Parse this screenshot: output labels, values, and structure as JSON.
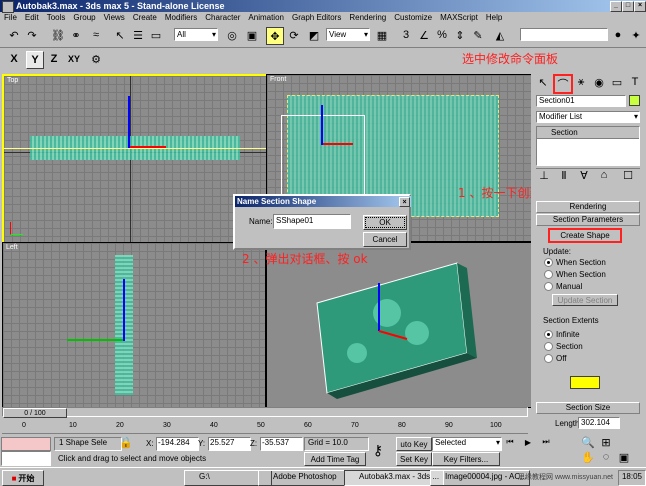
{
  "window": {
    "title": "Autobak3.max - 3ds max 5 - Stand-alone License"
  },
  "menu": [
    "File",
    "Edit",
    "Tools",
    "Group",
    "Views",
    "Create",
    "Modifiers",
    "Character",
    "Animation",
    "Graph Editors",
    "Rendering",
    "Customize",
    "MAXScript",
    "Help"
  ],
  "toolbar": {
    "selection_filter": "All",
    "ref_coord": "View"
  },
  "axis_buttons": [
    "X",
    "Y",
    "Z",
    "XY"
  ],
  "viewports": {
    "top": "Top",
    "front": "Front",
    "left": "Left"
  },
  "dialog": {
    "title": "Name Section Shape",
    "name_label": "Name:",
    "name_value": "SShape01",
    "ok_label": "OK",
    "cancel_label": "Cancel"
  },
  "command_panel": {
    "object_name": "Section01",
    "modifier_list": "Modifier List",
    "stack_item": "Section",
    "rollout_rendering": "Rendering",
    "rollout_section_params": "Section Parameters",
    "create_shape_label": "Create Shape",
    "update_label": "Update:",
    "update_options": [
      "When Section",
      "When Section",
      "Manual"
    ],
    "update_section_btn": "Update Section",
    "extents_label": "Section Extents",
    "extents_options": [
      "Infinite",
      "Section",
      "Off"
    ],
    "rollout_section_size": "Section Size",
    "length_label": "Length:",
    "length_value": "302.104"
  },
  "annotations": {
    "select_modify": "选中修改命令面板",
    "step1": "1 、按一下创建二维线按扭",
    "step2": "2 、弹出对话框、按 ok"
  },
  "timeline": {
    "frame_display": "0 / 100",
    "ticks": [
      "0",
      "10",
      "20",
      "30",
      "40",
      "50",
      "60",
      "70",
      "80",
      "90",
      "100"
    ]
  },
  "status": {
    "selected": "1 Shape Sele",
    "x_label": "X:",
    "x_value": "-194.284",
    "y_label": "Y:",
    "y_value": "25.527",
    "z_label": "Z:",
    "z_value": "-35.537",
    "grid": "Grid = 10.0",
    "prompt": "Click and drag to select and move objects",
    "add_time_tag": "Add Time Tag",
    "auto_key": "uto Key",
    "set_key": "Set Key",
    "selected_dropdown": "Selected",
    "key_filters": "Key Filters..."
  },
  "taskbar": {
    "start": "开始",
    "items": [
      "G:\\",
      "Adobe Photoshop",
      "Autobak3.max - 3ds ...",
      "Image00004.jpg - AC..."
    ],
    "clock": "18:05",
    "watermark": "思缘教程网 www.missyuan.net"
  },
  "colors": {
    "highlight_red": "#ff2020",
    "viewport_border_active": "#ffff00",
    "swatch": "#ffff00",
    "teal": "#40a090"
  }
}
